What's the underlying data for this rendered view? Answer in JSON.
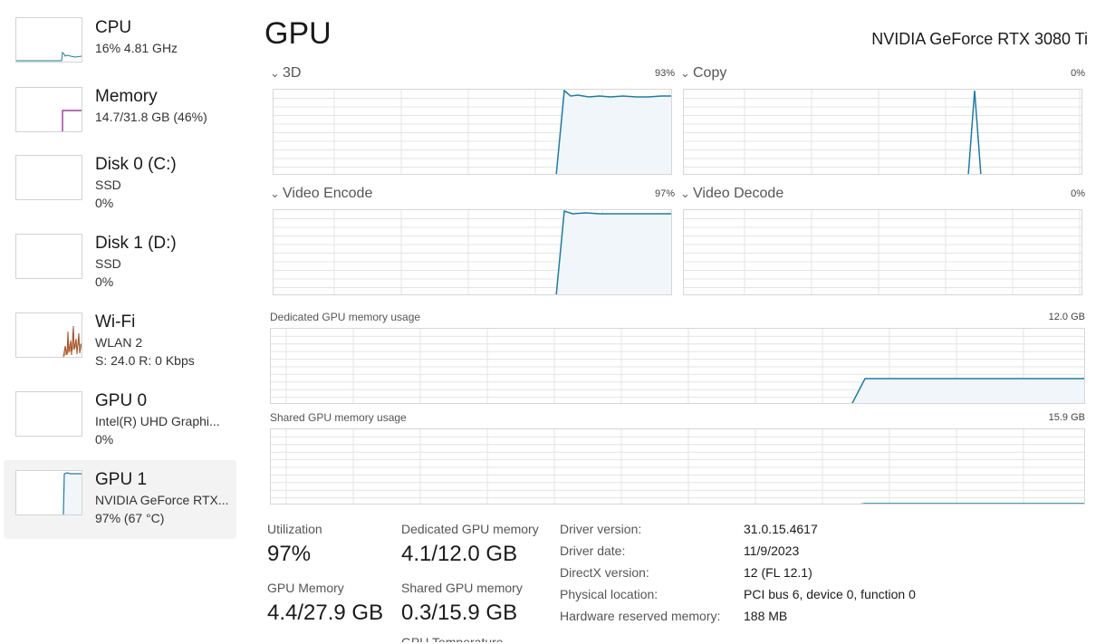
{
  "sidebar": {
    "items": [
      {
        "title": "CPU",
        "sub1": "16%  4.81 GHz",
        "sub2": ""
      },
      {
        "title": "Memory",
        "sub1": "14.7/31.8 GB (46%)",
        "sub2": ""
      },
      {
        "title": "Disk 0 (C:)",
        "sub1": "SSD",
        "sub2": "0%"
      },
      {
        "title": "Disk 1 (D:)",
        "sub1": "SSD",
        "sub2": "0%"
      },
      {
        "title": "Wi-Fi",
        "sub1": "WLAN 2",
        "sub2": "S: 24.0  R: 0 Kbps"
      },
      {
        "title": "GPU 0",
        "sub1": "Intel(R) UHD Graphi...",
        "sub2": "0%"
      },
      {
        "title": "GPU 1",
        "sub1": "NVIDIA GeForce RTX...",
        "sub2": "97%  (67 °C)"
      }
    ],
    "selected": "GPU 1"
  },
  "header": {
    "title": "GPU",
    "device": "NVIDIA GeForce RTX 3080 Ti"
  },
  "engines": [
    {
      "name": "3D",
      "percent": "93%"
    },
    {
      "name": "Copy",
      "percent": "0%"
    },
    {
      "name": "Video Encode",
      "percent": "97%"
    },
    {
      "name": "Video Decode",
      "percent": "0%"
    }
  ],
  "memory_charts": [
    {
      "label": "Dedicated GPU memory usage",
      "max": "12.0 GB"
    },
    {
      "label": "Shared GPU memory usage",
      "max": "15.9 GB"
    }
  ],
  "stats": {
    "utilization_label": "Utilization",
    "utilization_value": "97%",
    "dedicated_label": "Dedicated GPU memory",
    "dedicated_value": "4.1/12.0 GB",
    "gpu_memory_label": "GPU Memory",
    "gpu_memory_value": "4.4/27.9 GB",
    "shared_label": "Shared GPU memory",
    "shared_value": "0.3/15.9 GB",
    "temperature_label": "GPU Temperature"
  },
  "info": [
    {
      "key": "Driver version:",
      "value": "31.0.15.4617"
    },
    {
      "key": "Driver date:",
      "value": "11/9/2023"
    },
    {
      "key": "DirectX version:",
      "value": "12 (FL 12.1)"
    },
    {
      "key": "Physical location:",
      "value": "PCI bus 6, device 0, function 0"
    },
    {
      "key": "Hardware reserved memory:",
      "value": "188 MB"
    }
  ],
  "colors": {
    "gpu_line": "#1f7ba6",
    "gpu_fill": "#f1f6fa",
    "cpu_line": "#1f7ba6",
    "memory_line": "#8b1c8b",
    "wifi_line": "#a0522d",
    "grid": "#e4e4e4",
    "chart_border": "#d6d6d6"
  },
  "icons": {
    "chart_header": "chevron-down-icon"
  }
}
